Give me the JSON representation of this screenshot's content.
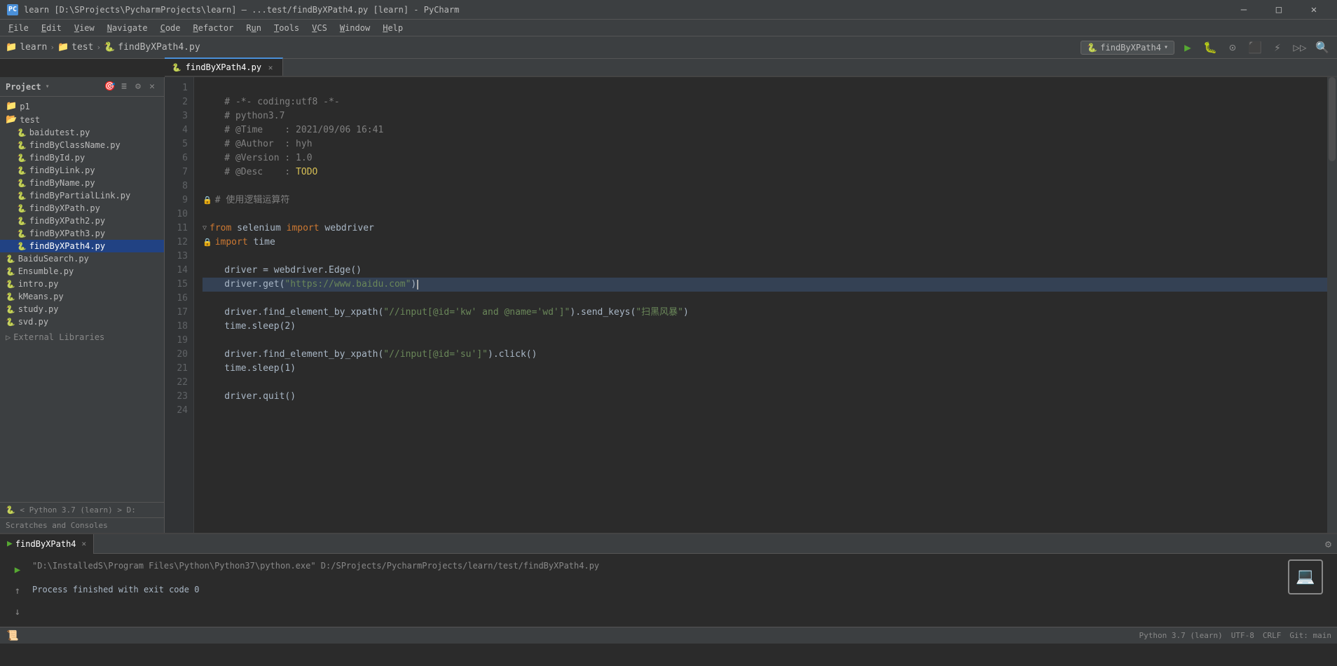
{
  "window": {
    "title": "learn [D:\\SProjects\\PycharmProjects\\learn] – ...test/findByXPath4.py [learn] - PyCharm",
    "icon": "PC"
  },
  "titlebar": {
    "title": "learn [D:\\SProjects\\PycharmProjects\\learn] – ...test/findByXPath4.py [learn] - PyCharm",
    "minimize": "—",
    "maximize": "□",
    "close": "✕"
  },
  "menubar": {
    "items": [
      "File",
      "Edit",
      "View",
      "Navigate",
      "Code",
      "Refactor",
      "Run",
      "Tools",
      "VCS",
      "Window",
      "Help"
    ]
  },
  "navbar": {
    "breadcrumbs": [
      "learn",
      "test",
      "findByXPath4.py"
    ],
    "run_config": "findByXPath4"
  },
  "tabs": {
    "active": "findByXPath4.py",
    "items": [
      "findByXPath4.py"
    ]
  },
  "sidebar": {
    "title": "Project",
    "items": [
      {
        "label": "p1",
        "type": "folder",
        "indent": 0
      },
      {
        "label": "test",
        "type": "folder",
        "indent": 0
      },
      {
        "label": "baidutest.py",
        "type": "file",
        "indent": 1
      },
      {
        "label": "findByClassName.py",
        "type": "file",
        "indent": 1
      },
      {
        "label": "findById.py",
        "type": "file",
        "indent": 1
      },
      {
        "label": "findByLink.py",
        "type": "file",
        "indent": 1
      },
      {
        "label": "findByName.py",
        "type": "file",
        "indent": 1
      },
      {
        "label": "findByPartialLink.py",
        "type": "file",
        "indent": 1
      },
      {
        "label": "findByXPath.py",
        "type": "file",
        "indent": 1
      },
      {
        "label": "findByXPath2.py",
        "type": "file",
        "indent": 1
      },
      {
        "label": "findByXPath3.py",
        "type": "file",
        "indent": 1
      },
      {
        "label": "findByXPath4.py",
        "type": "file",
        "indent": 1,
        "selected": true
      },
      {
        "label": "BaiduSearch.py",
        "type": "file",
        "indent": 0
      },
      {
        "label": "Ensumble.py",
        "type": "file",
        "indent": 0
      },
      {
        "label": "intro.py",
        "type": "file",
        "indent": 0
      },
      {
        "label": "kMeans.py",
        "type": "file",
        "indent": 0
      },
      {
        "label": "study.py",
        "type": "file",
        "indent": 0
      },
      {
        "label": "svd.py",
        "type": "file",
        "indent": 0
      }
    ],
    "footer1": "External Libraries",
    "footer2": "🐍 < Python 3.7 (learn) >  D:",
    "footer3": "Scratches and Consoles"
  },
  "code": {
    "lines": [
      {
        "num": 1,
        "content": "",
        "type": "blank"
      },
      {
        "num": 2,
        "content": "    # -*- coding:utf8 -*-",
        "type": "comment"
      },
      {
        "num": 3,
        "content": "    # python3.7",
        "type": "comment"
      },
      {
        "num": 4,
        "content": "    # @Time    : 2021/09/06 16:41",
        "type": "comment"
      },
      {
        "num": 5,
        "content": "    # @Author  : hyh",
        "type": "comment"
      },
      {
        "num": 6,
        "content": "    # @Version : 1.0",
        "type": "comment"
      },
      {
        "num": 7,
        "content": "    # @Desc    : TODO",
        "type": "comment_todo"
      },
      {
        "num": 8,
        "content": "",
        "type": "blank"
      },
      {
        "num": 9,
        "content": "  # 使用逻辑运算符",
        "type": "comment_cn"
      },
      {
        "num": 10,
        "content": "",
        "type": "blank"
      },
      {
        "num": 11,
        "content": "from selenium import webdriver",
        "type": "import"
      },
      {
        "num": 12,
        "content": "import time",
        "type": "import"
      },
      {
        "num": 13,
        "content": "",
        "type": "blank"
      },
      {
        "num": 14,
        "content": "    driver = webdriver.Edge()",
        "type": "code"
      },
      {
        "num": 15,
        "content": "    driver.get(\"https://www.baidu.com\")",
        "type": "code_str"
      },
      {
        "num": 16,
        "content": "",
        "type": "blank"
      },
      {
        "num": 17,
        "content": "    driver.find_element_by_xpath(\"//input[@id='kw' and @name='wd']\").send_keys(\"扫黑风暴\")",
        "type": "code"
      },
      {
        "num": 18,
        "content": "    time.sleep(2)",
        "type": "code"
      },
      {
        "num": 19,
        "content": "",
        "type": "blank"
      },
      {
        "num": 20,
        "content": "    driver.find_element_by_xpath(\"//input[@id='su']\").click()",
        "type": "code"
      },
      {
        "num": 21,
        "content": "    time.sleep(1)",
        "type": "code"
      },
      {
        "num": 22,
        "content": "",
        "type": "blank"
      },
      {
        "num": 23,
        "content": "    driver.quit()",
        "type": "code"
      },
      {
        "num": 24,
        "content": "",
        "type": "blank"
      }
    ]
  },
  "run_panel": {
    "tab_label": "findByXPath4",
    "command": "\"D:\\InstalledS\\Program Files\\Python\\Python37\\python.exe\" D:/SProjects/PycharmProjects/learn/test/findByXPath4.py",
    "exit_message": "Process finished with exit code 0"
  },
  "status_bar": {
    "python": "Python 3.7 (learn)",
    "encoding": "UTF-8",
    "line_sep": "CRLF",
    "git": "Git: main"
  }
}
